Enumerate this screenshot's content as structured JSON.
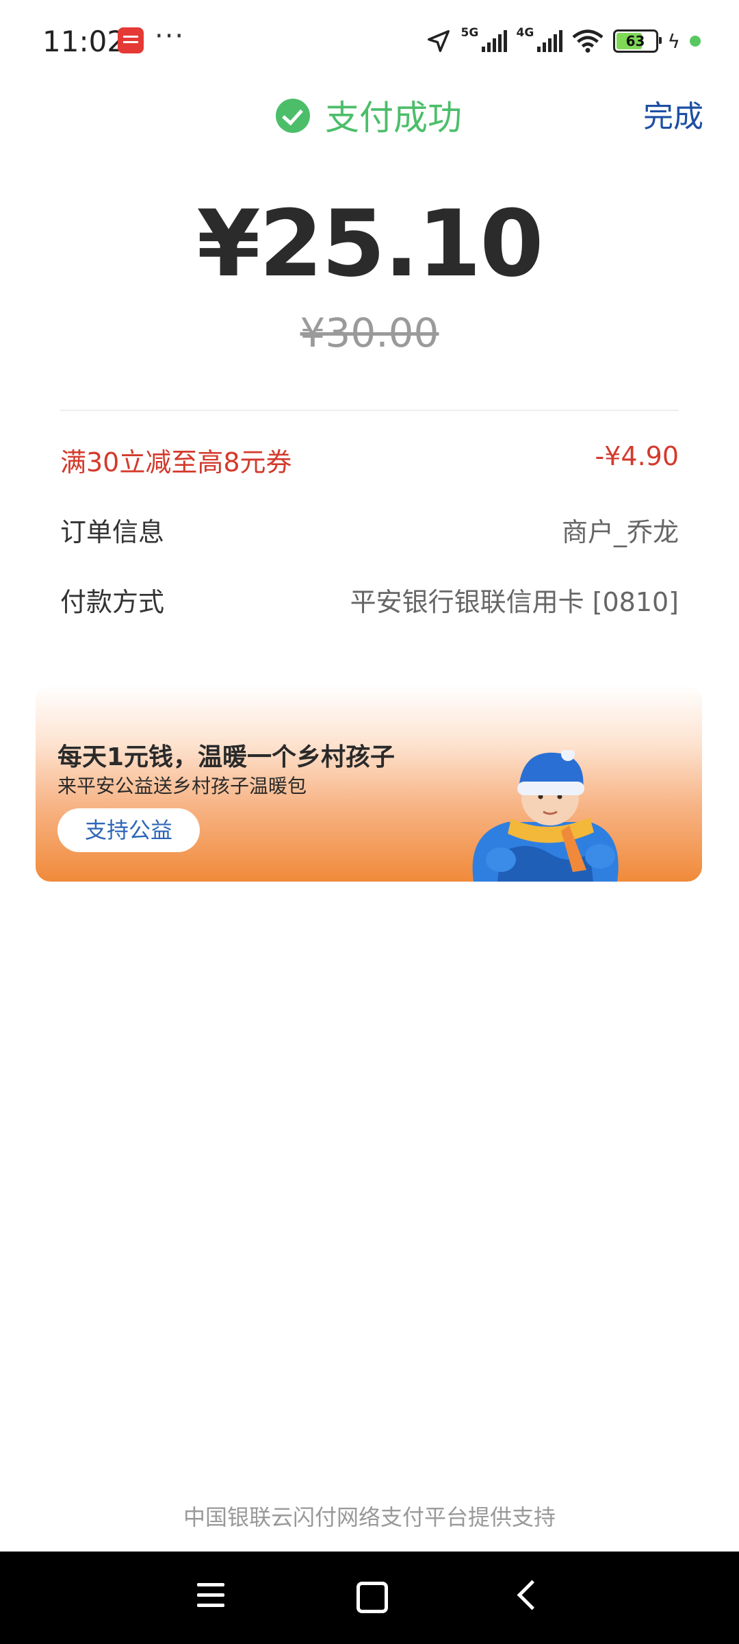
{
  "status_bar": {
    "time": "11:02",
    "app_icon": "union-pay-app-icon",
    "more": "···",
    "network_5g": "5G",
    "network_4g": "4G",
    "battery": "63"
  },
  "header": {
    "title": "支付成功",
    "done_label": "完成",
    "accent_color": "#4cbe6a"
  },
  "payment": {
    "amount": "¥25.10",
    "original_amount": "¥30.00"
  },
  "details": [
    {
      "label": "满30立减至高8元券",
      "value": "-¥4.90"
    },
    {
      "label": "订单信息",
      "value": "商户_乔龙"
    },
    {
      "label": "付款方式",
      "value": "平安银行银联信用卡 [0810]"
    }
  ],
  "banner": {
    "headline": "每天1元钱，温暖一个乡村孩子",
    "subline": "来平安公益送乡村孩子温暖包",
    "button_label": "支持公益"
  },
  "footer": {
    "text": "中国银联云闪付网络支付平台提供支持"
  },
  "nav": {
    "menu_icon": "menu-icon",
    "home_icon": "home-icon",
    "back_icon": "back-icon"
  }
}
